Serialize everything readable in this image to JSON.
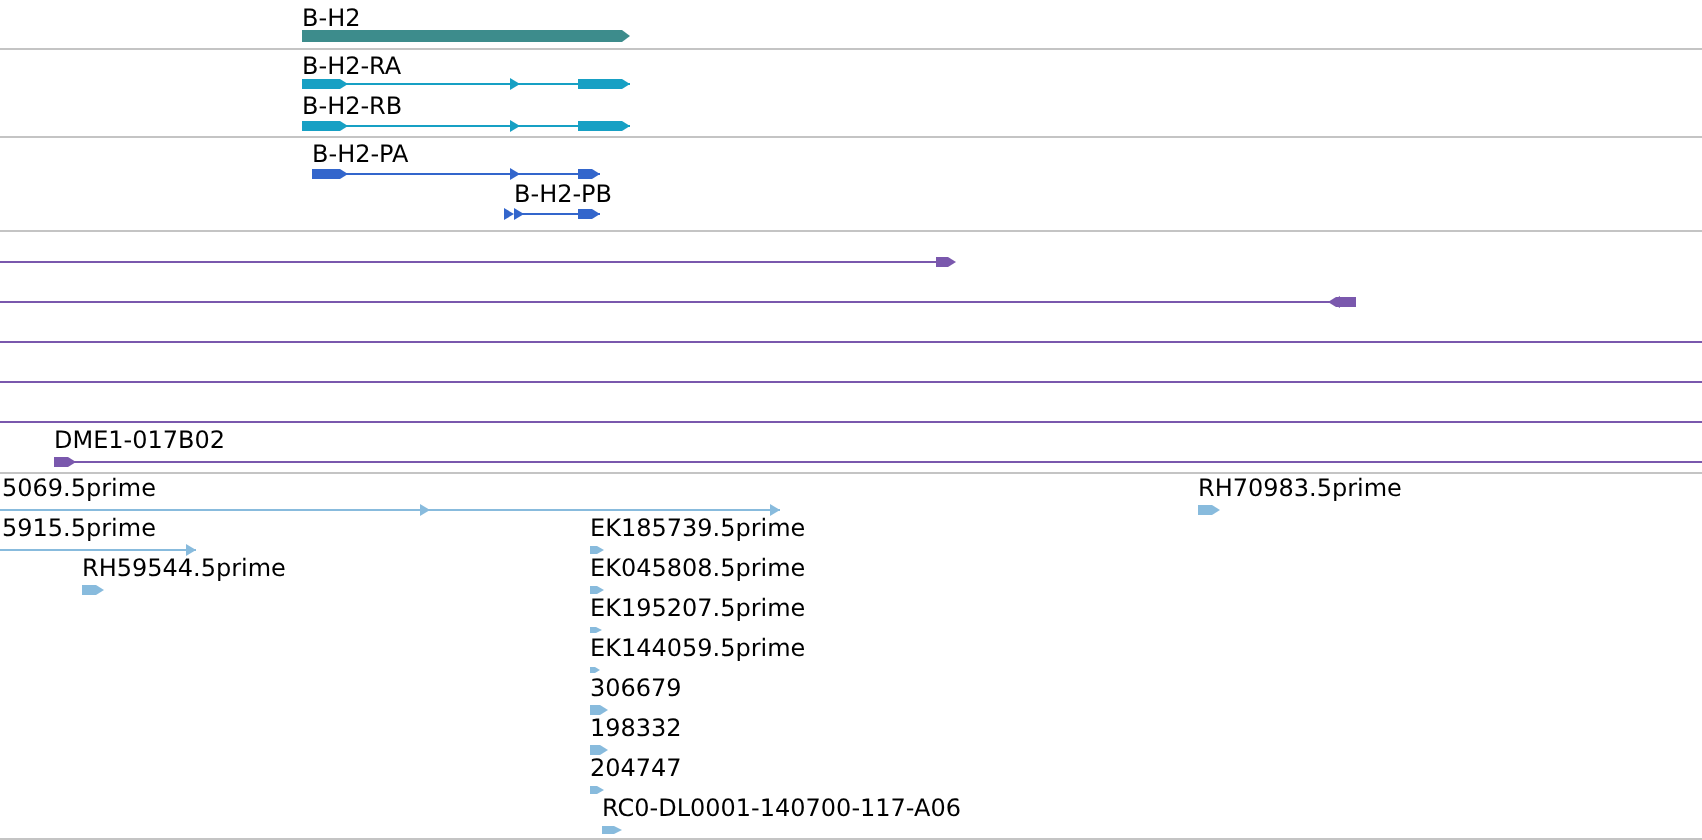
{
  "tracks": [
    {
      "kind": "genes",
      "features": [
        {
          "kind": "gene",
          "label": "B-H2"
        }
      ]
    },
    {
      "kind": "transcripts",
      "features": [
        {
          "kind": "transcript",
          "label": "B-H2-RA"
        },
        {
          "kind": "transcript",
          "label": "B-H2-RB"
        }
      ]
    },
    {
      "kind": "proteins",
      "features": [
        {
          "kind": "protein",
          "label": "B-H2-PA"
        },
        {
          "kind": "protein",
          "label": "B-H2-PB"
        }
      ]
    },
    {
      "kind": "matches",
      "features": [
        {
          "kind": "match"
        },
        {
          "kind": "match"
        },
        {
          "kind": "match"
        },
        {
          "kind": "match"
        },
        {
          "kind": "match"
        },
        {
          "kind": "match",
          "label": "DME1-017B02"
        }
      ]
    },
    {
      "kind": "ests",
      "features": [
        {
          "kind": "est",
          "label": "5069.5prime"
        },
        {
          "kind": "est",
          "label": "5915.5prime"
        },
        {
          "kind": "est",
          "label": "RH59544.5prime"
        },
        {
          "kind": "est",
          "label": "RH70983.5prime"
        },
        {
          "kind": "est",
          "label": "EK185739.5prime"
        },
        {
          "kind": "est",
          "label": "EK045808.5prime"
        },
        {
          "kind": "est",
          "label": "EK195207.5prime"
        },
        {
          "kind": "est",
          "label": "EK144059.5prime"
        },
        {
          "kind": "est",
          "label": "306679"
        },
        {
          "kind": "est",
          "label": "198332"
        },
        {
          "kind": "est",
          "label": "204747"
        },
        {
          "kind": "est",
          "label": "RC0-DL0001-140700-117-A06"
        }
      ]
    }
  ]
}
